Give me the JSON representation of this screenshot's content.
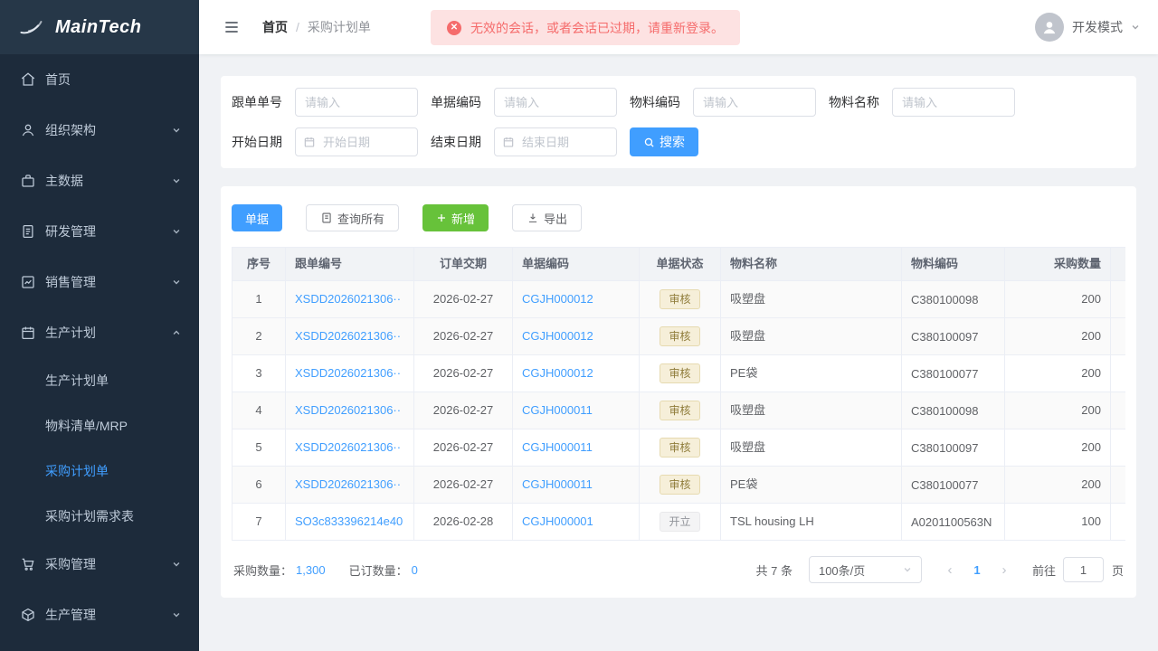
{
  "brand": {
    "name": "MainTech"
  },
  "sidebar": {
    "items": [
      {
        "label": "首页",
        "icon": "home-icon"
      },
      {
        "label": "组织架构",
        "icon": "user-icon"
      },
      {
        "label": "主数据",
        "icon": "briefcase-icon"
      },
      {
        "label": "研发管理",
        "icon": "document-icon"
      },
      {
        "label": "销售管理",
        "icon": "sales-chart-icon"
      },
      {
        "label": "生产计划",
        "icon": "calendar-icon",
        "expanded": true,
        "children": [
          "生产计划单",
          "物料清单/MRP",
          "采购计划单",
          "采购计划需求表"
        ],
        "active_child": "采购计划单"
      },
      {
        "label": "采购管理",
        "icon": "cart-icon"
      },
      {
        "label": "生产管理",
        "icon": "box-icon"
      }
    ]
  },
  "header": {
    "breadcrumb": {
      "home": "首页",
      "current": "采购计划单"
    },
    "alert_message": "无效的会话，或者会话已过期，请重新登录。",
    "user_mode": "开发模式"
  },
  "filters": {
    "fields": [
      {
        "label": "跟单单号",
        "placeholder": "请输入"
      },
      {
        "label": "单据编码",
        "placeholder": "请输入"
      },
      {
        "label": "物料编码",
        "placeholder": "请输入"
      },
      {
        "label": "物料名称",
        "placeholder": "请输入"
      },
      {
        "label": "开始日期",
        "placeholder": "开始日期"
      },
      {
        "label": "结束日期",
        "placeholder": "结束日期"
      }
    ],
    "search_label": "搜索"
  },
  "toolbar": {
    "document_btn": "单据",
    "query_all_btn": "查询所有",
    "add_btn": "新增",
    "export_btn": "导出"
  },
  "table": {
    "headers": [
      "序号",
      "跟单编号",
      "订单交期",
      "单据编码",
      "单据状态",
      "物料名称",
      "物料编码",
      "采购数量"
    ],
    "rows": [
      {
        "seq": "1",
        "order_no": "XSDD2026021306··",
        "delivery_date": "2026-02-27",
        "doc_no": "CGJH000012",
        "status": "审核",
        "status_type": "warning",
        "material_name": "吸塑盘",
        "material_code": "C380100098",
        "qty": "200"
      },
      {
        "seq": "2",
        "order_no": "XSDD2026021306··",
        "delivery_date": "2026-02-27",
        "doc_no": "CGJH000012",
        "status": "审核",
        "status_type": "warning",
        "material_name": "吸塑盘",
        "material_code": "C380100097",
        "qty": "200"
      },
      {
        "seq": "3",
        "order_no": "XSDD2026021306··",
        "delivery_date": "2026-02-27",
        "doc_no": "CGJH000012",
        "status": "审核",
        "status_type": "warning",
        "material_name": "PE袋",
        "material_code": "C380100077",
        "qty": "200"
      },
      {
        "seq": "4",
        "order_no": "XSDD2026021306··",
        "delivery_date": "2026-02-27",
        "doc_no": "CGJH000011",
        "status": "审核",
        "status_type": "warning",
        "material_name": "吸塑盘",
        "material_code": "C380100098",
        "qty": "200"
      },
      {
        "seq": "5",
        "order_no": "XSDD2026021306··",
        "delivery_date": "2026-02-27",
        "doc_no": "CGJH000011",
        "status": "审核",
        "status_type": "warning",
        "material_name": "吸塑盘",
        "material_code": "C380100097",
        "qty": "200"
      },
      {
        "seq": "6",
        "order_no": "XSDD2026021306··",
        "delivery_date": "2026-02-27",
        "doc_no": "CGJH000011",
        "status": "审核",
        "status_type": "warning",
        "material_name": "PE袋",
        "material_code": "C380100077",
        "qty": "200"
      },
      {
        "seq": "7",
        "order_no": "SO3c833396214e40",
        "delivery_date": "2026-02-28",
        "doc_no": "CGJH000001",
        "status": "开立",
        "status_type": "info",
        "material_name": "TSL housing LH",
        "material_code": "A0201100563N",
        "qty": "100"
      }
    ]
  },
  "summary": {
    "purchase_qty_label": "采购数量：",
    "purchase_qty": "1,300",
    "ordered_qty_label": "已订数量：",
    "ordered_qty": "0"
  },
  "pagination": {
    "total_text": "共 7 条",
    "page_size": "100条/页",
    "prev": "‹",
    "current_page": "1",
    "next": "›",
    "goto_label": "前往",
    "goto_value": "1",
    "page_unit": "页"
  },
  "colors": {
    "primary": "#409eff",
    "success": "#67c23a",
    "danger": "#f56c6c",
    "sidebar_bg": "#1d2b3b"
  }
}
